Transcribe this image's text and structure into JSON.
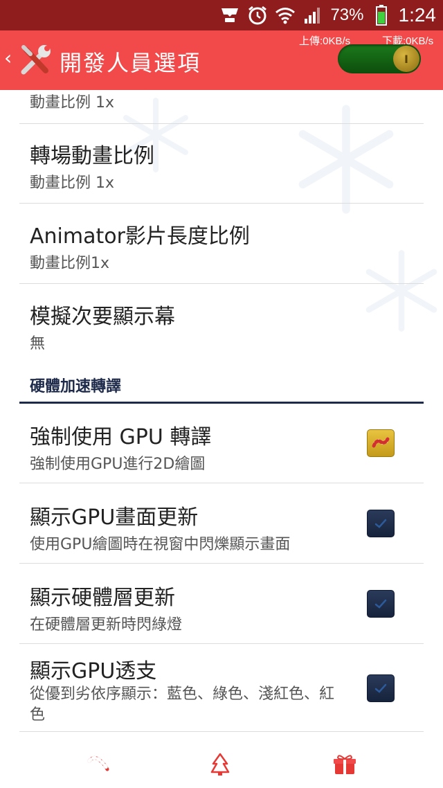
{
  "status_bar": {
    "battery_percent": "73%",
    "time": "1:24",
    "icons": [
      "notification-icon",
      "alarm-icon",
      "wifi-icon",
      "signal-icon",
      "battery-icon"
    ]
  },
  "action_bar": {
    "title": "開發人員選項",
    "upload_speed": "上傳:0KB/s",
    "download_speed": "下載:0KB/s",
    "master_toggle": {
      "state": "on",
      "knob_label": "I"
    }
  },
  "preferences_top": [
    {
      "title": "",
      "summary": "動畫比例 1x"
    },
    {
      "title": "轉場動畫比例",
      "summary": "動畫比例 1x"
    },
    {
      "title": "Animator影片長度比例",
      "summary": "動畫比例1x"
    },
    {
      "title": "模擬次要顯示幕",
      "summary": "無"
    }
  ],
  "category": {
    "label": "硬體加速轉譯"
  },
  "preferences_hw": [
    {
      "title": "強制使用 GPU 轉譯",
      "summary": "強制使用GPU進行2D繪圖",
      "checked": true
    },
    {
      "title": "顯示GPU畫面更新",
      "summary": "使用GPU繪圖時在視窗中閃爍顯示畫面",
      "checked": false
    },
    {
      "title": "顯示硬體層更新",
      "summary": "在硬體層更新時閃綠燈",
      "checked": false
    },
    {
      "title": "顯示GPU透支",
      "summary": "從優到劣依序顯示：藍色、綠色、淺紅色、紅色",
      "checked": false
    }
  ],
  "colors": {
    "status_bar": "#8f1d1d",
    "action_bar": "#f24a4a",
    "category_accent": "#1d2a4a",
    "checkbox_on": "#d4aa2a",
    "checkbox_off": "#1e2d4a"
  },
  "bottom_nav": [
    "candy-cane-icon",
    "christmas-tree-icon",
    "gift-icon"
  ]
}
